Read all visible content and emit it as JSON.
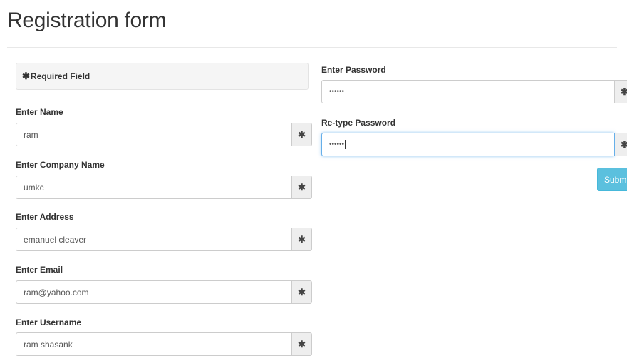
{
  "page": {
    "title": "Registration form"
  },
  "required_note": {
    "asterisk": "✱",
    "text": "Required Field"
  },
  "fields": [
    {
      "label": "Enter Name",
      "value": "ram"
    },
    {
      "label": "Enter Company Name",
      "value": "umkc"
    },
    {
      "label": "Enter Address",
      "value": "emanuel cleaver"
    },
    {
      "label": "Enter Email",
      "value": "ram@yahoo.com"
    },
    {
      "label": "Enter Username",
      "value": "ram shasank"
    }
  ],
  "password": {
    "label": "Enter Password",
    "value": "••••••"
  },
  "retype_password": {
    "label": "Re-type Password",
    "value": "••••••"
  },
  "addon_symbol": "✱",
  "submit_label": "Submit",
  "colors": {
    "submit_bg": "#5bc0de",
    "focus_border": "#66afe9",
    "addon_bg": "#eeeeee"
  }
}
